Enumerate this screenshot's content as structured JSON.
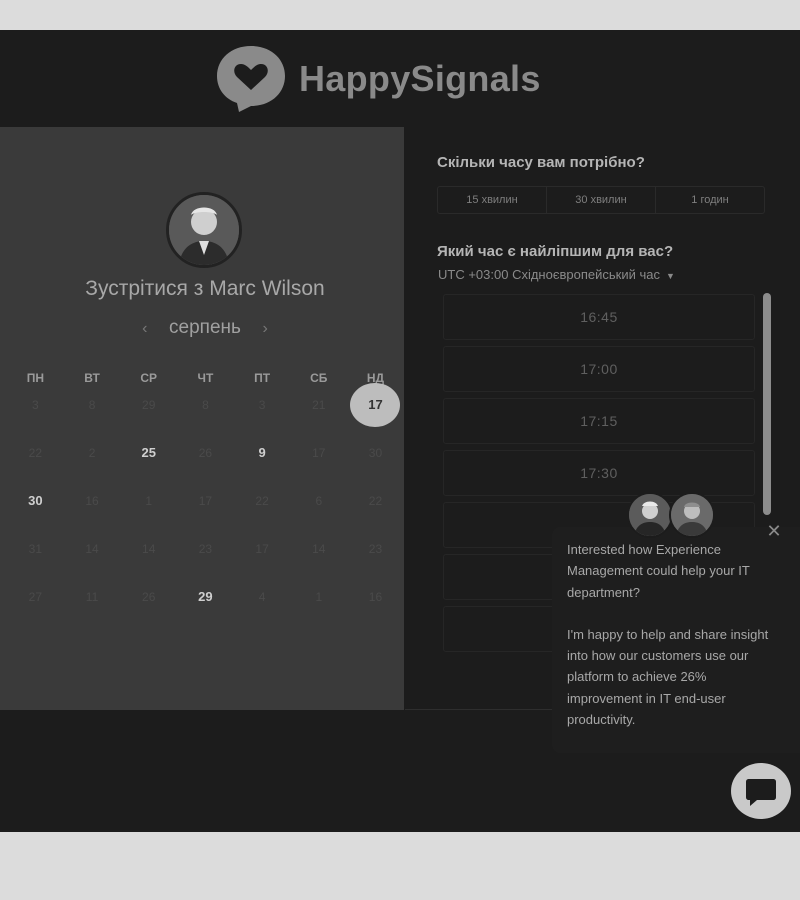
{
  "brand": {
    "name": "HappySignals",
    "logo_icon": "heart-speech-bubble-icon"
  },
  "calendar": {
    "host_avatar": "avatar",
    "title": "Зустрітися з Marc Wilson",
    "month_label": "серпень",
    "prev_icon": "‹",
    "next_icon": "›",
    "weekdays": [
      "ПН",
      "ВТ",
      "СР",
      "ЧТ",
      "ПТ",
      "СБ",
      "НД"
    ],
    "weeks": [
      [
        {
          "d": "3",
          "a": false
        },
        {
          "d": "8",
          "a": false
        },
        {
          "d": "29",
          "a": false
        },
        {
          "d": "8",
          "a": false
        },
        {
          "d": "3",
          "a": false
        },
        {
          "d": "21",
          "a": false
        },
        {
          "d": "17",
          "a": true,
          "sel": true
        }
      ],
      [
        {
          "d": "22",
          "a": false
        },
        {
          "d": "2",
          "a": false
        },
        {
          "d": "25",
          "a": true
        },
        {
          "d": "26",
          "a": false
        },
        {
          "d": "9",
          "a": true
        },
        {
          "d": "17",
          "a": false
        },
        {
          "d": "30",
          "a": false
        }
      ],
      [
        {
          "d": "30",
          "a": true
        },
        {
          "d": "16",
          "a": false
        },
        {
          "d": "1",
          "a": false
        },
        {
          "d": "17",
          "a": false
        },
        {
          "d": "22",
          "a": false
        },
        {
          "d": "6",
          "a": false
        },
        {
          "d": "22",
          "a": false
        }
      ],
      [
        {
          "d": "31",
          "a": false
        },
        {
          "d": "14",
          "a": false
        },
        {
          "d": "14",
          "a": false
        },
        {
          "d": "23",
          "a": false
        },
        {
          "d": "17",
          "a": false
        },
        {
          "d": "14",
          "a": false
        },
        {
          "d": "23",
          "a": false
        }
      ],
      [
        {
          "d": "27",
          "a": false
        },
        {
          "d": "11",
          "a": false
        },
        {
          "d": "26",
          "a": false
        },
        {
          "d": "29",
          "a": true
        },
        {
          "d": "4",
          "a": false
        },
        {
          "d": "1",
          "a": false
        },
        {
          "d": "16",
          "a": false
        }
      ]
    ]
  },
  "scheduler": {
    "duration_question": "Скільки часу вам потрібно?",
    "durations": [
      "15 хвилин",
      "30 хвилин",
      "1 годин"
    ],
    "time_question": "Який час є найліпшим для вас?",
    "timezone": "UTC +03:00 Східноєвропейський час",
    "slots": [
      "16:45",
      "17:00",
      "17:15",
      "17:30",
      "",
      "",
      ""
    ]
  },
  "chat": {
    "message_1": "Interested how Experience Management could help your IT department?",
    "message_2": "I'm happy to help and share insight into how our customers use our platform to achieve 26% improvement in IT end-user productivity.",
    "close_icon": "✕",
    "launcher_icon": "chat-bubble-icon"
  },
  "colors": {
    "background": "#1c1c1c",
    "panel": "#3a3a3a",
    "selected_day": "#bdbdbd",
    "logo": "#8a8a8a"
  }
}
